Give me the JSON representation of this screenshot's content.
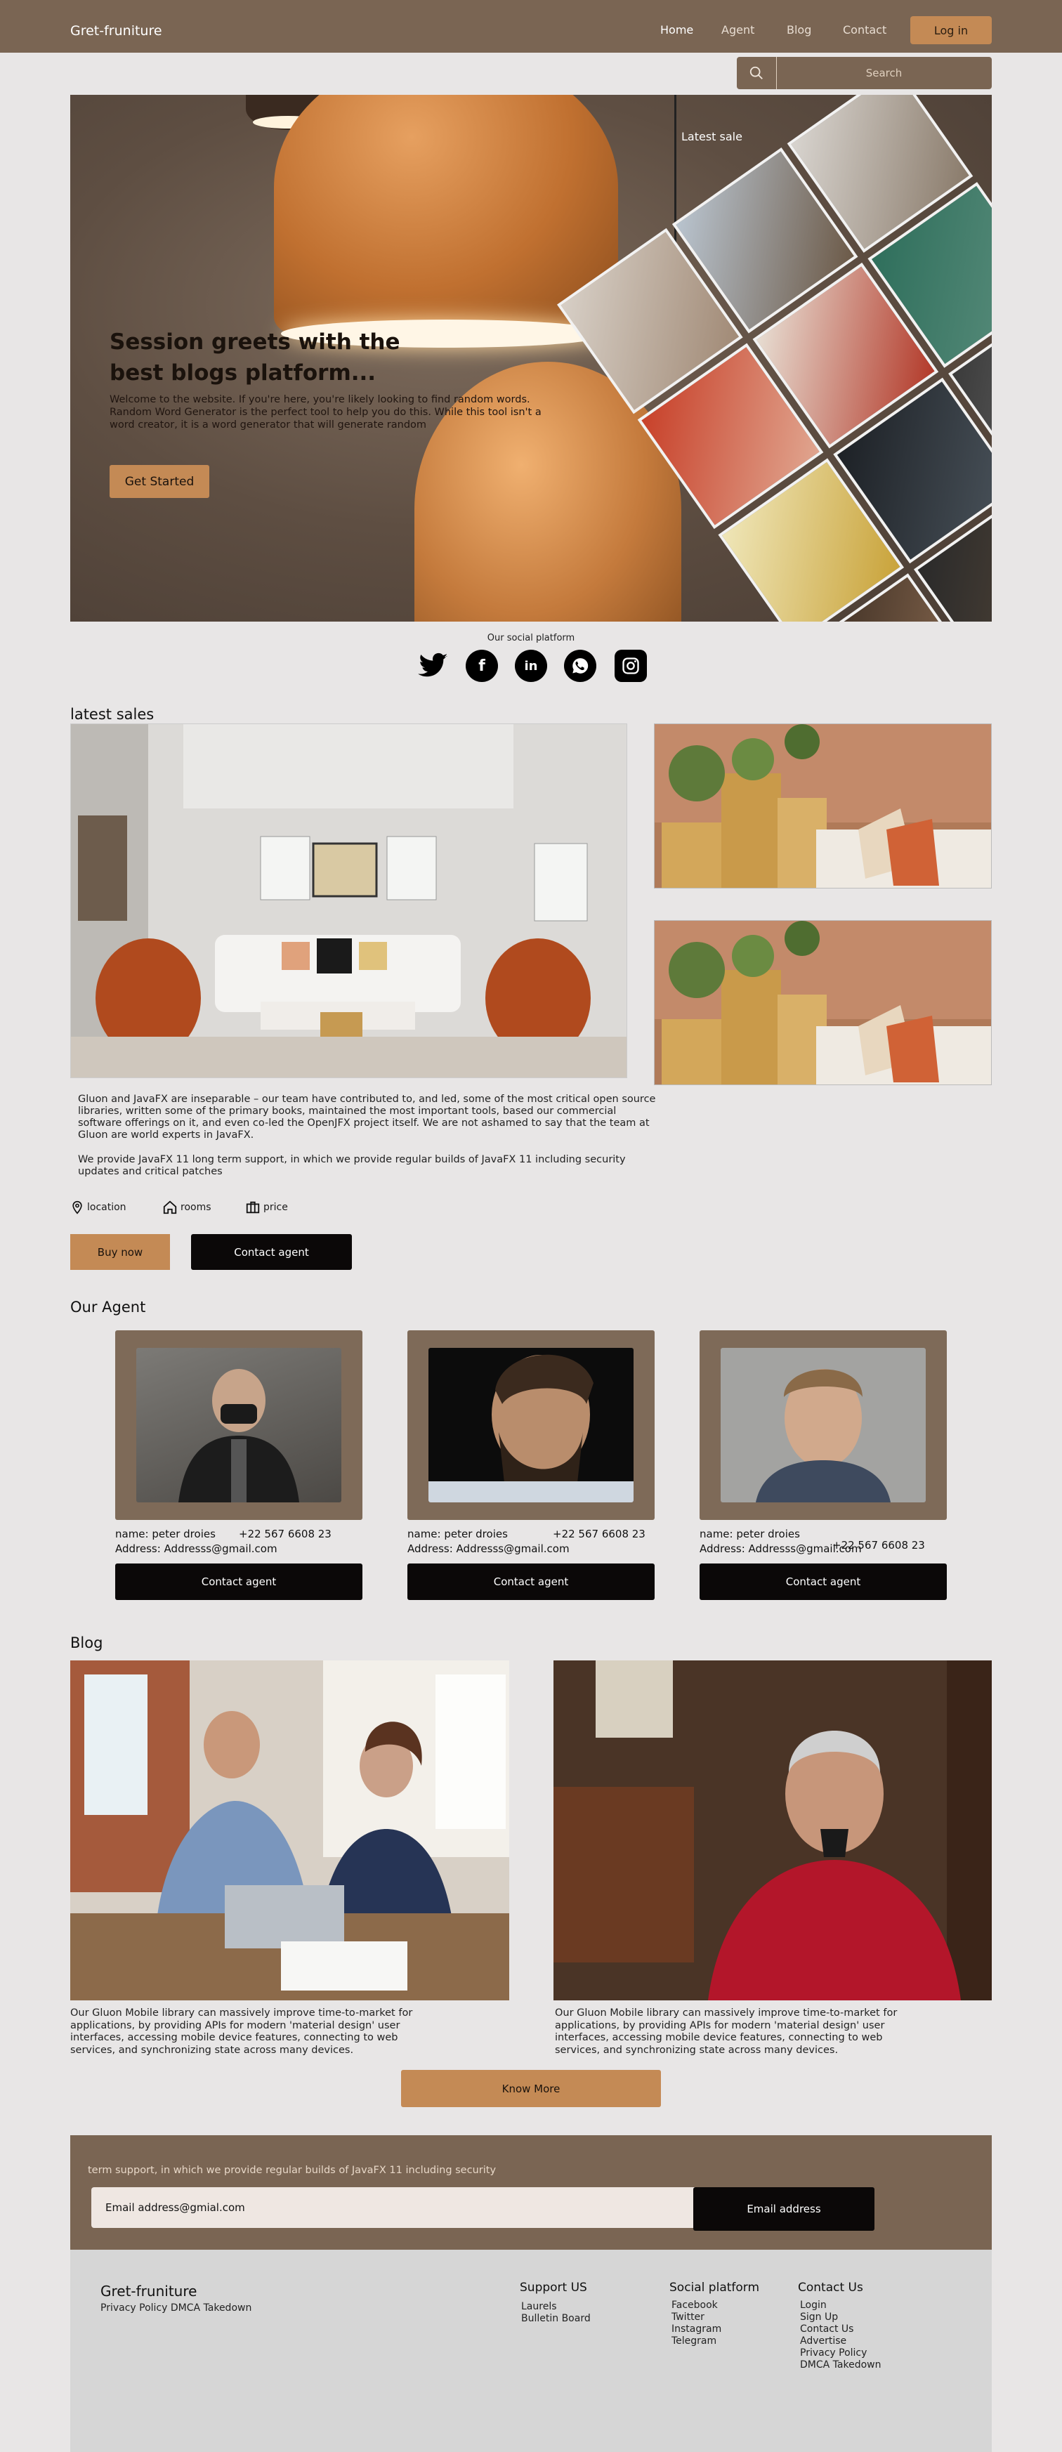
{
  "header": {
    "brand": "Gret-fruniture",
    "nav": [
      "Home",
      "Agent",
      "Blog",
      "Contact"
    ],
    "login": "Log in",
    "search_placeholder": "Search"
  },
  "hero": {
    "title": "Session greets with  the best  blogs platform...",
    "description": "Welcome to the website. If you're here, you're likely looking to find random words. Random Word Generator is the perfect tool to help you do this. While this tool isn't a word creator, it is a word generator that will generate random",
    "cta": "Get Started",
    "latest_sale_label": "Latest sale"
  },
  "social": {
    "label": "Our social platform",
    "icons": [
      "twitter-icon",
      "facebook-icon",
      "linkedin-icon",
      "whatsapp-icon",
      "instagram-icon"
    ]
  },
  "sales": {
    "title": "latest sales",
    "p1": "Gluon and JavaFX are inseparable – our team have contributed to, and led, some of the most critical open source libraries, written some of the primary books, maintained the most important tools, based our commercial software offerings on it, and even co-led the OpenJFX project itself. We are not ashamed to say that the team at Gluon are world experts in JavaFX.",
    "p2": "We provide JavaFX 11 long term support, in which we provide regular builds of JavaFX 11 including security updates and critical patches",
    "meta": [
      "location",
      "rooms",
      "price"
    ],
    "buy": "Buy now",
    "contact": "Contact agent"
  },
  "agents": {
    "title": "Our Agent",
    "items": [
      {
        "name": "name:  peter droies",
        "phone": "+22 567 6608 23",
        "address": "Address:  Addresss@gmail.com",
        "button": "Contact agent"
      },
      {
        "name": "name:  peter droies",
        "phone": "+22 567 6608 23",
        "address": "Address:  Addresss@gmail.com",
        "button": "Contact agent"
      },
      {
        "name": "name:  peter droies",
        "phone": "+22 567 6608 23",
        "address": "Address:  Addresss@gmail.com",
        "button": "Contact agent"
      }
    ]
  },
  "blog": {
    "title": "Blog",
    "posts": [
      {
        "text": "Our Gluon Mobile library can massively improve time-to-market for applications, by providing APIs for modern 'material design' user interfaces, accessing mobile device features, connecting to web services, and synchronizing state across many devices."
      },
      {
        "text": "Our Gluon Mobile library can massively improve time-to-market for applications, by providing APIs for modern 'material design' user interfaces, accessing mobile device features, connecting to web services, and synchronizing state across many devices."
      }
    ],
    "more": "Know More"
  },
  "newsletter": {
    "text": "term support, in which we provide regular builds of JavaFX 11 including security",
    "email_value": "Email address@gmial.com",
    "button": "Email address"
  },
  "footer": {
    "brand": "Gret-fruniture",
    "links": "Privacy Policy DMCA Takedown",
    "support": {
      "title": "Support US",
      "items": [
        "Laurels",
        "Bulletin Board"
      ]
    },
    "social": {
      "title": "Social platform",
      "items": [
        "Facebook",
        "Twitter",
        "Instagram",
        "Telegram"
      ]
    },
    "contact": {
      "title": "Contact Us",
      "items": [
        "Login",
        "Sign Up",
        "Contact Us",
        "Advertise",
        "Privacy Policy",
        "DMCA Takedown"
      ]
    }
  }
}
